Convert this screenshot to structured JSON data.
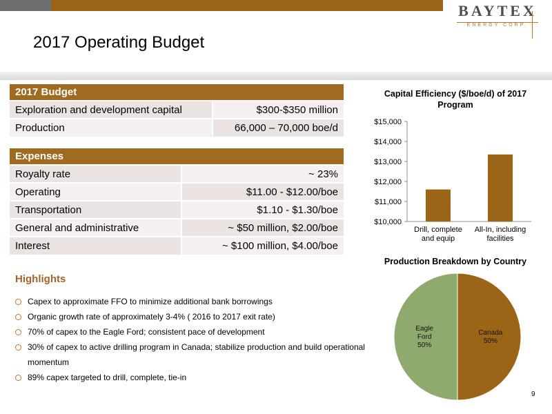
{
  "header": {
    "logo_main": "BAYTEX",
    "logo_sub": "ENERGY CORP.",
    "title": "2017 Operating Budget",
    "colors": {
      "brown": "#9c6416",
      "gray": "#6e6e6e"
    }
  },
  "budget": {
    "heading": "2017 Budget",
    "rows": [
      {
        "label": "Exploration and development capital",
        "value": "$300-$350 million"
      },
      {
        "label": "Production",
        "value": "66,000 – 70,000 boe/d"
      }
    ]
  },
  "expenses": {
    "heading": "Expenses",
    "rows": [
      {
        "label": "Royalty rate",
        "value": "~ 23%"
      },
      {
        "label": "Operating",
        "value": "$11.00 - $12.00/boe"
      },
      {
        "label": "Transportation",
        "value": "$1.10 - $1.30/boe"
      },
      {
        "label": "General and administrative",
        "value": "~ $50 million, $2.00/boe"
      },
      {
        "label": "Interest",
        "value": "~ $100 million, $4.00/boe"
      }
    ]
  },
  "highlights": {
    "title": "Highlights",
    "items": [
      "Capex to approximate FFO to minimize additional bank borrowings",
      "Organic growth rate of approximately 3-4% ( 2016 to 2017 exit rate)",
      "70% of capex to the Eagle Ford; consistent pace of development",
      "30% of capex to active drilling program in Canada; stabilize production and build operational momentum",
      "89% capex targeted to drill, complete, tie-in"
    ]
  },
  "chart_data": [
    {
      "type": "bar",
      "title": "Capital Efficiency ($/boe/d) of 2017 Program",
      "categories": [
        "Drill, complete and equip",
        "All-In, including facilities"
      ],
      "values": [
        11600,
        13350
      ],
      "ylim": [
        10000,
        15000
      ],
      "yticks": [
        10000,
        11000,
        12000,
        13000,
        14000,
        15000
      ],
      "ytick_labels": [
        "$10,000",
        "$11,000",
        "$12,000",
        "$13,000",
        "$14,000",
        "$15,000"
      ],
      "xlabel": "",
      "ylabel": "",
      "grid": false,
      "color": "#9c6416"
    },
    {
      "type": "pie",
      "title": "Production Breakdown by Country",
      "labels": [
        "Canada",
        "Eagle Ford"
      ],
      "values": [
        50,
        50
      ],
      "value_labels": [
        "50%",
        "50%"
      ],
      "colors": [
        "#9c6416",
        "#8faa6e"
      ]
    }
  ],
  "page_number": "9"
}
